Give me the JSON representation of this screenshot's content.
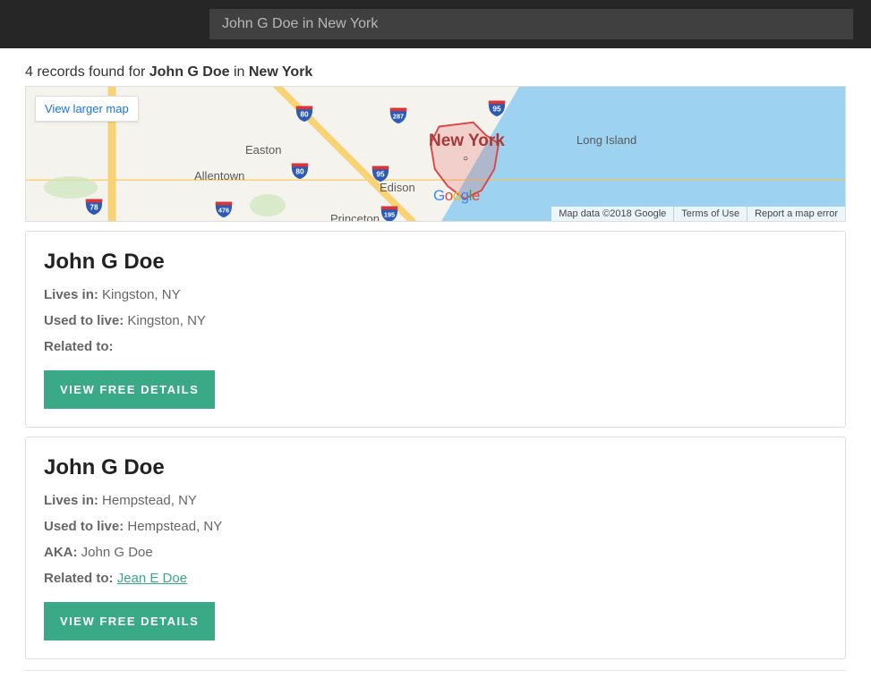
{
  "header": {
    "search_value": "John G Doe in New York"
  },
  "summary": {
    "prefix": "4 records found for ",
    "name": "John G Doe",
    "mid": " in ",
    "location": "New York"
  },
  "map": {
    "view_larger": "View larger map",
    "ny_label": "New York",
    "cities": {
      "allentown": "Allentown",
      "easton": "Easton",
      "edison": "Edison",
      "princeton": "Princeton",
      "long_island": "Long Island"
    },
    "shields": {
      "s80": "80",
      "s287": "287",
      "s95": "95",
      "s80b": "80",
      "s476": "476",
      "s78": "78",
      "s195": "195",
      "s95b": "95"
    },
    "footer": {
      "data": "Map data ©2018 Google",
      "terms": "Terms of Use",
      "report": "Report a map error"
    },
    "google": {
      "g": "G",
      "o1": "o",
      "o2": "o",
      "g2": "g",
      "l": "l",
      "e": "e"
    }
  },
  "labels": {
    "lives_in": "Lives in:",
    "used_to_live": "Used to live:",
    "related_to": "Related to:",
    "aka": "AKA:",
    "view_details": "VIEW FREE DETAILS"
  },
  "records": [
    {
      "name": "John G Doe",
      "lives_in": "Kingston, NY",
      "used_to_live": "Kingston, NY",
      "aka": null,
      "related_to": null
    },
    {
      "name": "John G Doe",
      "lives_in": "Hempstead, NY",
      "used_to_live": "Hempstead, NY",
      "aka": "John G Doe",
      "related_to": "Jean E Doe"
    }
  ]
}
